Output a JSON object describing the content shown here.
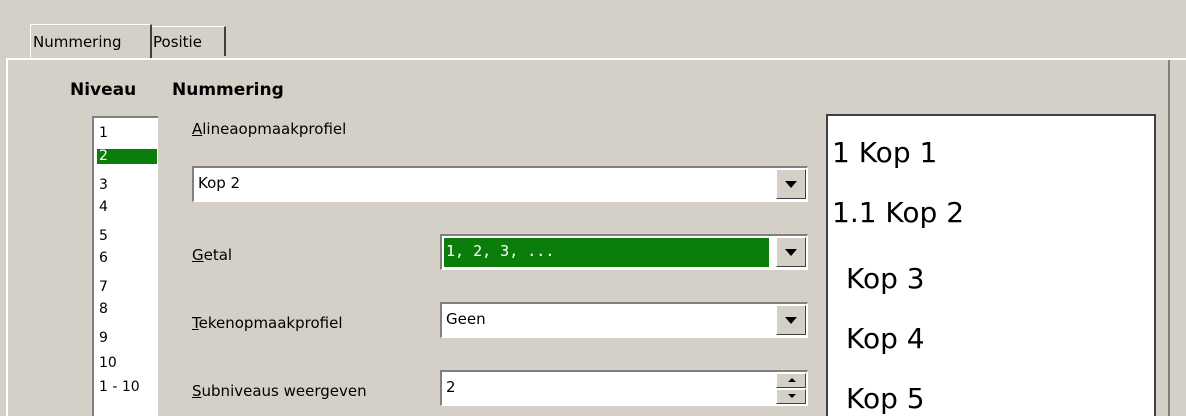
{
  "tabs": [
    {
      "label": "Nummering",
      "active": true
    },
    {
      "label": "Positie",
      "active": false
    }
  ],
  "headings": {
    "niveau": "Niveau",
    "nummering": "Nummering"
  },
  "levels": {
    "items": [
      "1",
      "2",
      "3",
      "4",
      "5",
      "6",
      "7",
      "8",
      "9",
      "10",
      "1 - 10"
    ],
    "selected": "2"
  },
  "form": {
    "paragraph_style": {
      "label_accel": "A",
      "label_rest": "lineaopmaakprofiel",
      "value": "Kop 2"
    },
    "number": {
      "label_accel": "G",
      "label_rest": "etal",
      "value": "1, 2, 3, ..."
    },
    "char_style": {
      "label_accel": "T",
      "label_rest": "ekenopmaakprofiel",
      "value": "Geen"
    },
    "sublevels": {
      "label_accel": "S",
      "label_rest": "ubniveaus weergeven",
      "value": "2"
    }
  },
  "preview": {
    "lines": [
      "1 Kop 1",
      "1.1 Kop 2",
      "Kop 3",
      "Kop 4",
      "Kop 5"
    ]
  },
  "colors": {
    "selection": "#0b7d0b",
    "dialog_bg": "#d4d0c8"
  }
}
